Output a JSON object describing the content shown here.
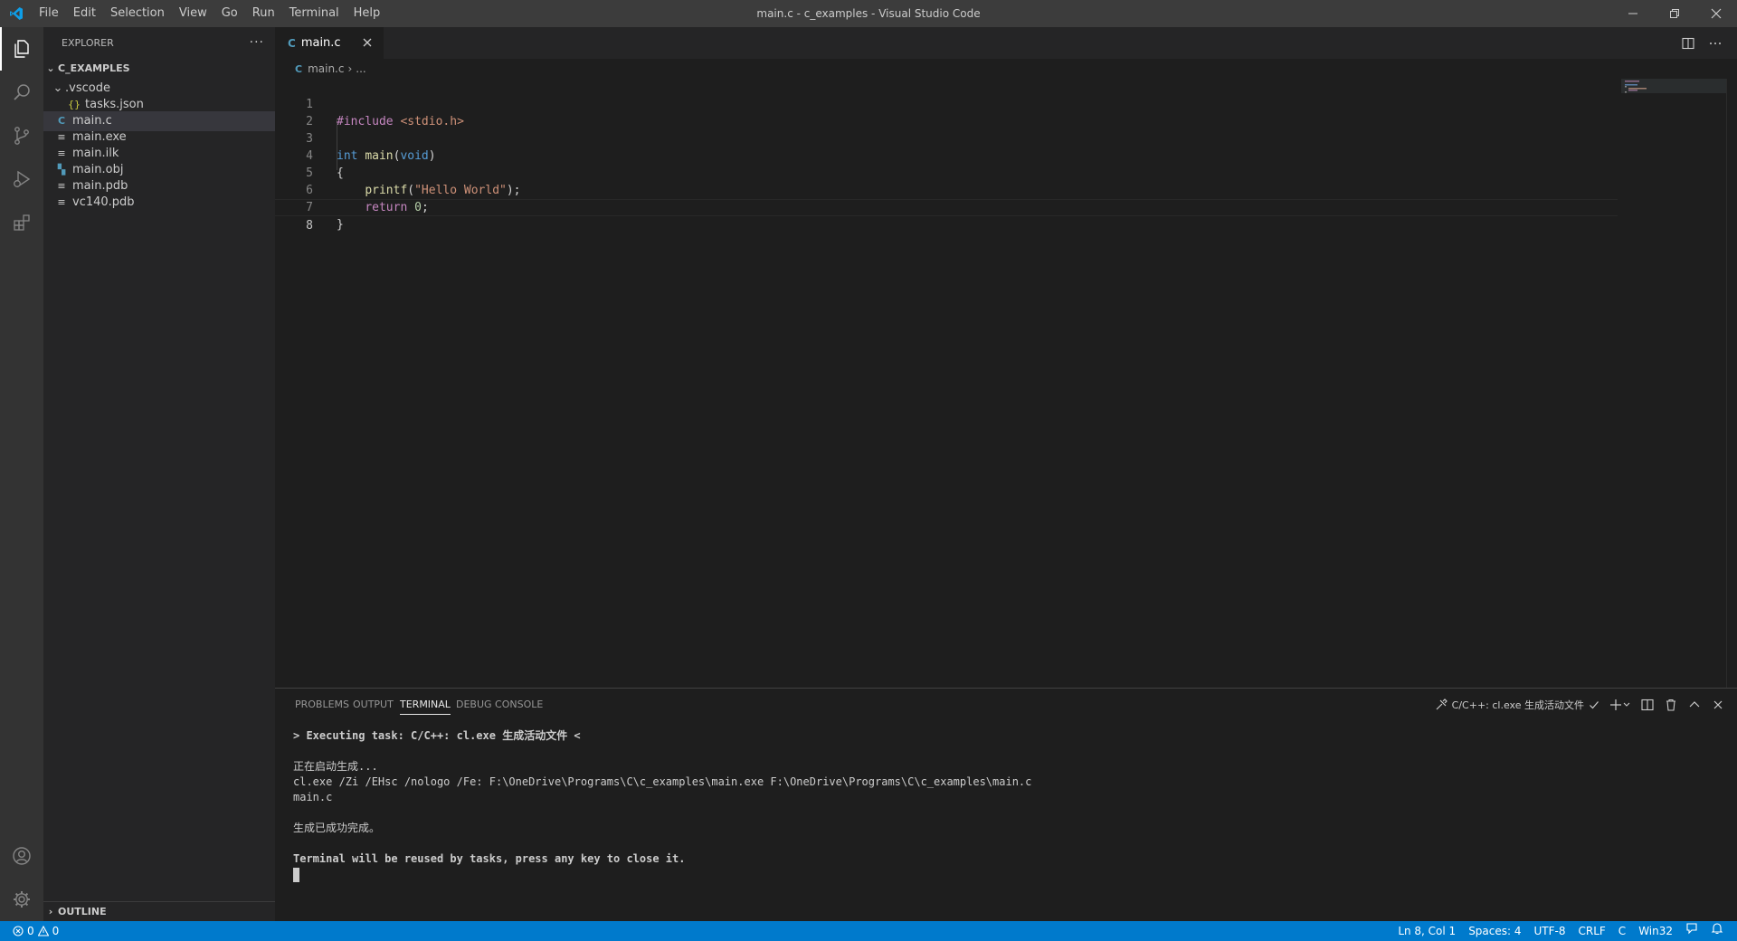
{
  "window": {
    "title": "main.c - c_examples - Visual Studio Code",
    "menu": [
      "File",
      "Edit",
      "Selection",
      "View",
      "Go",
      "Run",
      "Terminal",
      "Help"
    ]
  },
  "activity_bar": {
    "items": [
      "explorer-icon",
      "search-icon",
      "source-control-icon",
      "run-debug-icon",
      "extensions-icon"
    ],
    "bottom_items": [
      "account-icon",
      "manage-gear-icon"
    ]
  },
  "sidebar": {
    "title": "EXPLORER",
    "more": "···",
    "folder": "C_EXAMPLES",
    "tree": [
      {
        "label": ".vscode",
        "type": "folder",
        "icon": "chevron-down"
      },
      {
        "label": "tasks.json",
        "type": "json",
        "icon": "{}"
      },
      {
        "label": "main.c",
        "type": "c",
        "icon": "C"
      },
      {
        "label": "main.exe",
        "type": "file",
        "icon": "≡"
      },
      {
        "label": "main.ilk",
        "type": "file",
        "icon": "≡"
      },
      {
        "label": "main.obj",
        "type": "obj",
        "icon": "▚"
      },
      {
        "label": "main.pdb",
        "type": "file",
        "icon": "≡"
      },
      {
        "label": "vc140.pdb",
        "type": "file",
        "icon": "≡"
      }
    ],
    "outline": "OUTLINE"
  },
  "editor": {
    "tab": {
      "icon": "C",
      "label": "main.c",
      "close": "×"
    },
    "breadcrumb": {
      "icon": "C",
      "file": "main.c",
      "sep": "›",
      "rest": "..."
    },
    "line_numbers": [
      "1",
      "2",
      "3",
      "4",
      "5",
      "6",
      "7",
      "8"
    ],
    "code": {
      "l1_pre": "#include",
      "l1_str": "<stdio.h>",
      "l3_kw1": "int",
      "l3_fn": "main",
      "l3_p1": "(",
      "l3_kw2": "void",
      "l3_p2": ")",
      "l4": "{",
      "l5_fn": "printf",
      "l5_p1": "(",
      "l5_str": "\"Hello World\"",
      "l5_p2": ");",
      "l6_kw": "return",
      "l6_num": "0",
      "l6_p": ";",
      "l7": "}"
    }
  },
  "panel": {
    "tabs": [
      "PROBLEMS",
      "OUTPUT",
      "TERMINAL",
      "DEBUG CONSOLE"
    ],
    "active_tab": "TERMINAL",
    "task_label": "C/C++: cl.exe 生成活动文件",
    "terminal_lines": [
      "> Executing task: C/C++: cl.exe 生成活动文件 <",
      "",
      "正在启动生成...",
      "cl.exe /Zi /EHsc /nologo /Fe: F:\\OneDrive\\Programs\\C\\c_examples\\main.exe F:\\OneDrive\\Programs\\C\\c_examples\\main.c",
      "main.c",
      "",
      "生成已成功完成。",
      "",
      "Terminal will be reused by tasks, press any key to close it."
    ]
  },
  "status_bar": {
    "errors": "0",
    "warnings": "0",
    "position": "Ln 8, Col 1",
    "spaces": "Spaces: 4",
    "encoding": "UTF-8",
    "eol": "CRLF",
    "language": "C",
    "platform": "Win32"
  },
  "colors": {
    "accent": "#007acc",
    "title_bar": "#3c3c3c",
    "activity_bar": "#333333",
    "sidebar": "#252526",
    "editor": "#1e1e1e"
  }
}
